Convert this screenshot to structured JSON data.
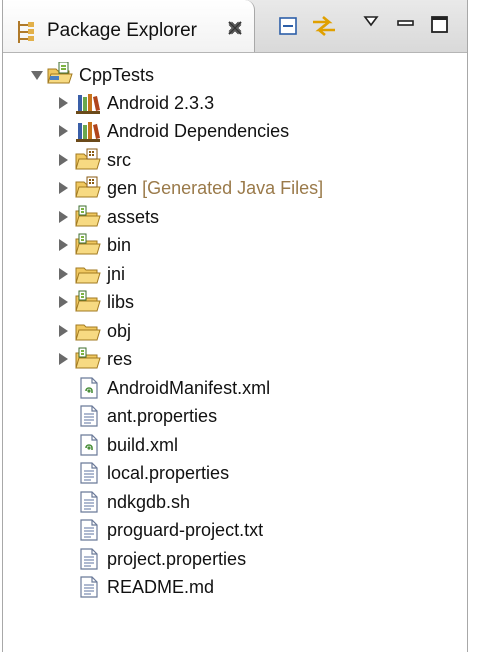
{
  "view": {
    "title": "Package Explorer",
    "close_glyph": "✕",
    "toolbar": [
      "collapse-all-icon",
      "link-with-editor-icon",
      "view-menu-icon",
      "minimize-icon",
      "maximize-icon"
    ]
  },
  "tree": {
    "project": "CppTests",
    "children": [
      {
        "label": "Android 2.3.3",
        "icon": "library-icon",
        "expandable": true
      },
      {
        "label": "Android Dependencies",
        "icon": "library-icon",
        "expandable": true
      },
      {
        "label": "src",
        "icon": "source-folder-icon",
        "expandable": true
      },
      {
        "label": "gen",
        "decoration": "[Generated Java Files]",
        "icon": "source-folder-icon",
        "expandable": true
      },
      {
        "label": "assets",
        "icon": "folder-icon",
        "expandable": true
      },
      {
        "label": "bin",
        "icon": "folder-icon",
        "expandable": true
      },
      {
        "label": "jni",
        "icon": "folder-icon",
        "expandable": true
      },
      {
        "label": "libs",
        "icon": "folder-icon",
        "expandable": true
      },
      {
        "label": "obj",
        "icon": "folder-icon",
        "expandable": true
      },
      {
        "label": "res",
        "icon": "folder-icon",
        "expandable": true
      },
      {
        "label": "AndroidManifest.xml",
        "icon": "xml-file-icon",
        "expandable": false
      },
      {
        "label": "ant.properties",
        "icon": "text-file-icon",
        "expandable": false
      },
      {
        "label": "build.xml",
        "icon": "xml-file-icon",
        "expandable": false
      },
      {
        "label": "local.properties",
        "icon": "text-file-icon",
        "expandable": false
      },
      {
        "label": "ndkgdb.sh",
        "icon": "text-file-icon",
        "expandable": false
      },
      {
        "label": "proguard-project.txt",
        "icon": "text-file-icon",
        "expandable": false
      },
      {
        "label": "project.properties",
        "icon": "text-file-icon",
        "expandable": false
      },
      {
        "label": "README.md",
        "icon": "text-file-icon",
        "expandable": false
      }
    ]
  },
  "colors": {
    "decoration": "#9a7a4a",
    "folder": "#f0c860",
    "library": "#c8741c"
  }
}
